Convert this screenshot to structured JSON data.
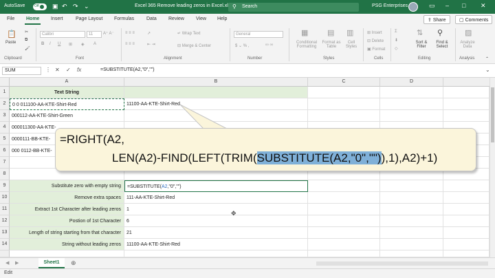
{
  "titlebar": {
    "autosave": "AutoSave",
    "toggle": "Off",
    "filename": "Excel 365 Remove leading zeros in Excel.xlsx",
    "search_placeholder": "Search",
    "user": "PSG Enterprises"
  },
  "menu": {
    "items": [
      "File",
      "Home",
      "Insert",
      "Page Layout",
      "Formulas",
      "Data",
      "Review",
      "View",
      "Help"
    ],
    "active": "Home",
    "share": "Share",
    "comments": "Comments"
  },
  "ribbon": {
    "paste": "Paste",
    "font_name": "Calibri",
    "font_size": "11",
    "wrap_text": "Wrap Text",
    "merge_center": "Merge & Center",
    "number_format": "General",
    "conditional_formatting": "Conditional Formatting",
    "format_as_table": "Format as Table",
    "cell_styles": "Cell Styles",
    "insert": "Insert",
    "delete": "Delete",
    "format": "Format",
    "sort_filter": "Sort & Filter",
    "find_select": "Find & Select",
    "analyze_data": "Analyze Data",
    "groups": {
      "clipboard": "Clipboard",
      "font": "Font",
      "alignment": "Alignment",
      "number": "Number",
      "styles": "Styles",
      "cells": "Cells",
      "editing": "Editing",
      "analysis": "Analysis"
    }
  },
  "formula_bar": {
    "name_box": "SUM",
    "formula": "=SUBSTITUTE(A2,\"0\",\"\")"
  },
  "columns": [
    "A",
    "B",
    "C",
    "D"
  ],
  "rows": [
    "1",
    "2",
    "3",
    "4",
    "5",
    "6",
    "7",
    "8",
    "9",
    "10",
    "11",
    "12",
    "13",
    "14"
  ],
  "cells": {
    "a1": "Text String",
    "a2": "0 0 011100-AA-KTE-Shirt-Red",
    "b2": "11100-AA-KTE-Shirt-Red",
    "a3": "000112-AA-KTE-Shirt-Green",
    "a4": "000011300-AA-KTE-",
    "a5": "0000111-BB-KTE-",
    "a6": "000 0112-BB-KTE-",
    "a9": "Substitute zero with empty string",
    "b9_pre": "=SUBSTITUTE(",
    "b9_ref": "A2",
    "b9_post": ",\"0\",\"\")",
    "a10": "Remove extra spaces",
    "b10": "111-AA-KTE-Shirt-Red",
    "a11": "Extract 1st Character after leading zeros",
    "b11": "1",
    "a12": "Postion of 1st Character",
    "b12": "6",
    "a13": "Length of string starting from that character",
    "b13": "21",
    "a14": "String without leading zeros",
    "b14": "11100-AA-KTE-Shirt-Red"
  },
  "callout": {
    "line1": "=RIGHT(A2,",
    "line2_pre": "LEN(A2)-FIND(LEFT(TRIM(",
    "line2_highlight": "SUBSTITUTE(A2,\"0\",\"\")",
    "line2_post": "),1),A2)+1)"
  },
  "sheet_tab": "Sheet1",
  "status": "Edit",
  "colors": {
    "accent": "#217346",
    "highlight": "#7fb0d8",
    "callout_bg": "#fbf5db",
    "label_bg": "#e2efda"
  }
}
